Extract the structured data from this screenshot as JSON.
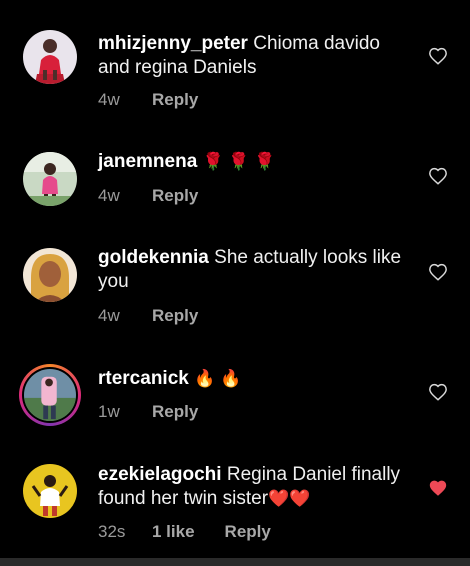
{
  "comments": [
    {
      "username": "mhizjenny_peter",
      "text": "Chioma davido and regina Daniels",
      "emoji": "",
      "time": "4w",
      "likes": "",
      "reply": "Reply",
      "heart_icon": "heart-outline-icon",
      "liked": false
    },
    {
      "username": "janemnena",
      "text": "",
      "emoji": "🌹 🌹 🌹",
      "time": "4w",
      "likes": "",
      "reply": "Reply",
      "heart_icon": "heart-outline-icon",
      "liked": false
    },
    {
      "username": "goldekennia",
      "text": "She actually looks like you",
      "emoji": "",
      "time": "4w",
      "likes": "",
      "reply": "Reply",
      "heart_icon": "heart-outline-icon",
      "liked": false
    },
    {
      "username": "rtercanick",
      "text": "",
      "emoji": "🔥 🔥",
      "time": "1w",
      "likes": "",
      "reply": "Reply",
      "heart_icon": "heart-outline-icon",
      "liked": false
    },
    {
      "username": "ezekielagochi",
      "text": "Regina Daniel finally found her twin sister",
      "emoji": "❤️❤️",
      "time": "32s",
      "likes": "1 like",
      "reply": "Reply",
      "heart_icon": "heart-filled-icon",
      "liked": true
    }
  ],
  "colors": {
    "background": "#000000",
    "text": "#f0f0f0",
    "meta": "#9a9a9a",
    "liked_heart": "#ed4956",
    "story_ring": "#dd2a7b"
  }
}
